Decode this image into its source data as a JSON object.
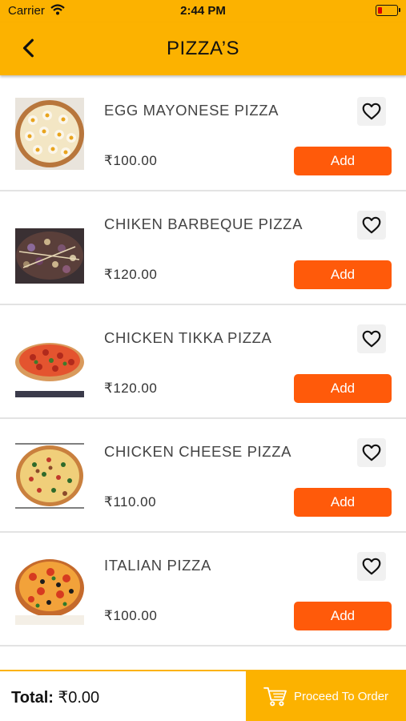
{
  "status_bar": {
    "carrier": "Carrier",
    "time": "2:44 PM"
  },
  "header": {
    "title": "PIZZA’S",
    "back_icon": "chevron-left-icon"
  },
  "items": [
    {
      "name": "EGG MAYONESE PIZZA",
      "price": "₹100.00",
      "add_label": "Add",
      "favorite_icon": "heart-outline-icon"
    },
    {
      "name": "CHIKEN BARBEQUE PIZZA",
      "price": "₹120.00",
      "add_label": "Add",
      "favorite_icon": "heart-outline-icon"
    },
    {
      "name": "CHICKEN TIKKA PIZZA",
      "price": "₹120.00",
      "add_label": "Add",
      "favorite_icon": "heart-outline-icon"
    },
    {
      "name": "CHICKEN CHEESE PIZZA",
      "price": "₹110.00",
      "add_label": "Add",
      "favorite_icon": "heart-outline-icon"
    },
    {
      "name": "ITALIAN PIZZA",
      "price": "₹100.00",
      "add_label": "Add",
      "favorite_icon": "heart-outline-icon"
    }
  ],
  "footer": {
    "total_label": "Total:",
    "total_value": "₹0.00",
    "proceed_label": "Proceed To Order",
    "cart_icon": "cart-icon"
  },
  "colors": {
    "primary": "#fcb200",
    "add_button": "#ff5a0a",
    "divider": "#e3e3e3"
  }
}
